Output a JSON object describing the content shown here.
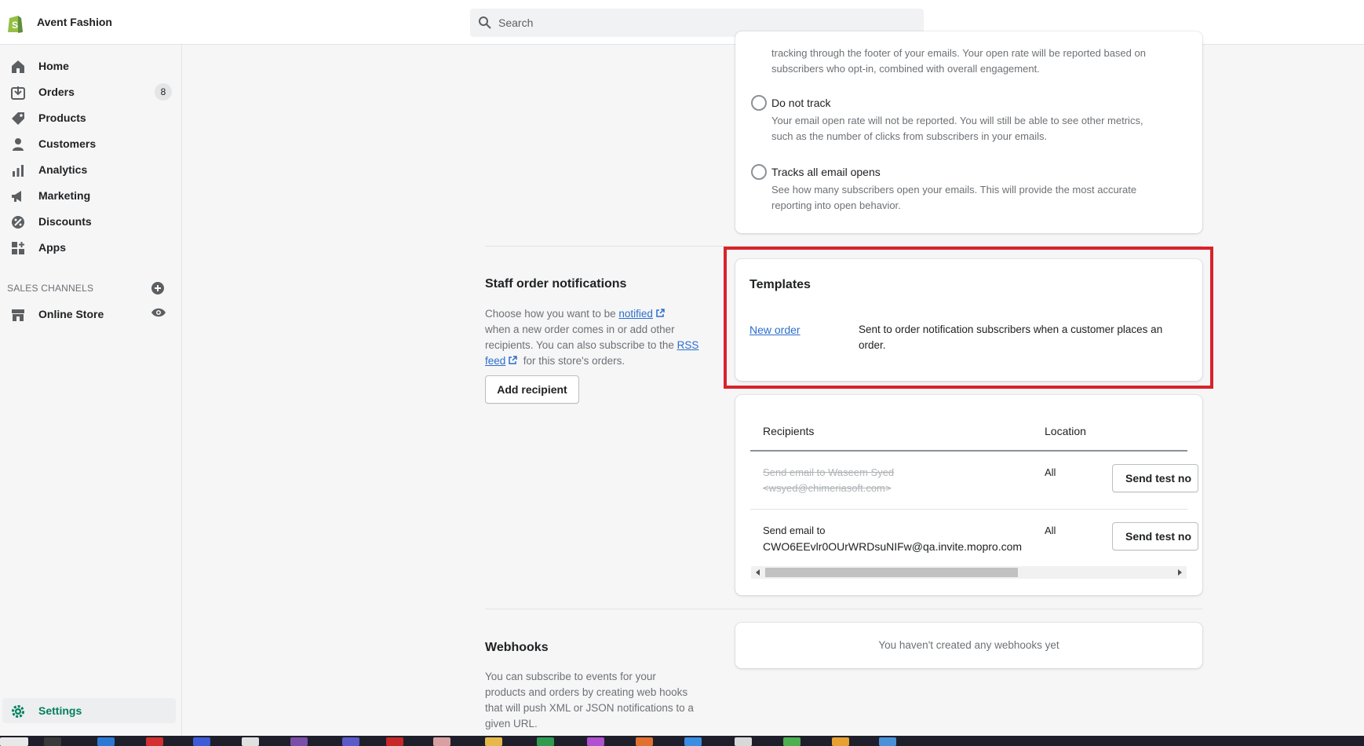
{
  "app": {
    "store_name": "Avent Fashion",
    "brand_color": "#95bf47",
    "accent_color": "#007f5f",
    "link_color": "#2c6ecb"
  },
  "search": {
    "placeholder": "Search"
  },
  "sidebar": {
    "items": [
      {
        "label": "Home",
        "icon": "home-icon"
      },
      {
        "label": "Orders",
        "icon": "orders-icon",
        "badge": "8"
      },
      {
        "label": "Products",
        "icon": "tag-icon"
      },
      {
        "label": "Customers",
        "icon": "person-icon"
      },
      {
        "label": "Analytics",
        "icon": "bar-chart-icon"
      },
      {
        "label": "Marketing",
        "icon": "megaphone-icon"
      },
      {
        "label": "Discounts",
        "icon": "discount-icon"
      },
      {
        "label": "Apps",
        "icon": "apps-icon"
      }
    ],
    "sales_channels_heading": "SALES CHANNELS",
    "online_store": "Online Store",
    "settings": "Settings"
  },
  "tracking_card": {
    "intro_line1": "tracking through the footer of your emails. Your open rate will be reported based on",
    "intro_line2": "subscribers who opt-in, combined with overall engagement.",
    "options": [
      {
        "label": "Do not track",
        "help1": "Your email open rate will not be reported. You will still be able to see other metrics,",
        "help2": "such as the number of clicks from subscribers in your emails."
      },
      {
        "label": "Tracks all email opens",
        "help1": "See how many subscribers open your emails. This will provide the most accurate",
        "help2": "reporting into open behavior."
      }
    ]
  },
  "staff_notifications": {
    "title": "Staff order notifications",
    "desc_1": "Choose how you want to be",
    "link_notified": "notified",
    "desc_2": "when a new order comes in or add other",
    "desc_3": "recipients. You can also subscribe to the",
    "link_rss_1": "RSS",
    "link_rss_2": "feed",
    "desc_4": "for this store's orders.",
    "add_recipient": "Add recipient",
    "templates": {
      "title": "Templates",
      "new_order_link": "New order",
      "new_order_desc_1": "Sent to order notification subscribers when a customer places an",
      "new_order_desc_2": "order."
    },
    "recipients_table": {
      "headers": [
        "Recipients",
        "Location"
      ],
      "rows": [
        {
          "line1": "Send email to Waseem Syed",
          "line2": "<wsyed@chimeriasoft.com>",
          "location": "All",
          "action": "Send test no"
        },
        {
          "line1": "Send email to",
          "line2": "CWO6EEvlr0OUrWRDsuNIFw@qa.invite.mopro.com",
          "location": "All",
          "action": "Send test no"
        }
      ]
    }
  },
  "webhooks": {
    "title": "Webhooks",
    "desc_1": "You can subscribe to events for your",
    "desc_2": "products and orders by creating web hooks",
    "desc_3": "that will push XML or JSON notifications to a",
    "desc_4": "given URL.",
    "empty": "You haven't created any webhooks yet"
  }
}
